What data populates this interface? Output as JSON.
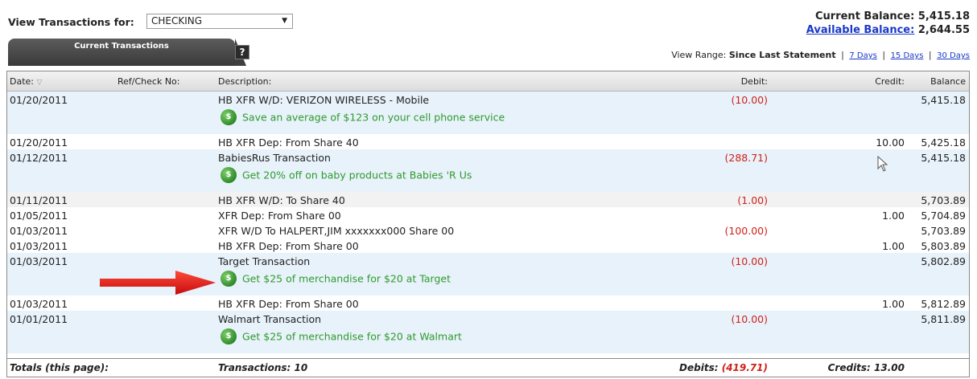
{
  "header": {
    "view_for_label": "View Transactions for:",
    "account_selected": "CHECKING",
    "current_balance": "Current Balance: 5,415.18",
    "available_balance_label": "Available Balance:",
    "available_balance_value": "2,644.55"
  },
  "tab": {
    "label": "Current Transactions",
    "help": "?"
  },
  "view_range": {
    "label": "View Range:",
    "selected": "Since Last Statement",
    "options": [
      "7 Days",
      "15 Days",
      "30 Days"
    ]
  },
  "columns": {
    "date": "Date:",
    "ref": "Ref/Check No:",
    "description": "Description:",
    "debit": "Debit:",
    "credit": "Credit:",
    "balance": "Balance"
  },
  "rows": [
    {
      "date": "01/20/2011",
      "description": "HB XFR W/D: VERIZON WIRELESS - Mobile",
      "debit": "(10.00)",
      "credit": "",
      "balance": "5,415.18",
      "offer": "Save an average of $123 on your cell phone service"
    },
    {
      "date": "01/20/2011",
      "description": "HB XFR Dep: From Share 40",
      "debit": "",
      "credit": "10.00",
      "balance": "5,425.18",
      "offer": ""
    },
    {
      "date": "01/12/2011",
      "description": "BabiesRus Transaction",
      "debit": "(288.71)",
      "credit": "",
      "balance": "5,415.18",
      "offer": "Get 20% off on baby products at Babies 'R Us"
    },
    {
      "date": "01/11/2011",
      "description": "HB XFR W/D: To Share 40",
      "debit": "(1.00)",
      "credit": "",
      "balance": "5,703.89",
      "offer": ""
    },
    {
      "date": "01/05/2011",
      "description": "XFR Dep: From Share 00",
      "debit": "",
      "credit": "1.00",
      "balance": "5,704.89",
      "offer": ""
    },
    {
      "date": "01/03/2011",
      "description": "XFR W/D To HALPERT,JIM xxxxxxx000 Share 00",
      "debit": "(100.00)",
      "credit": "",
      "balance": "5,703.89",
      "offer": ""
    },
    {
      "date": "01/03/2011",
      "description": "HB XFR Dep: From Share 00",
      "debit": "",
      "credit": "1.00",
      "balance": "5,803.89",
      "offer": ""
    },
    {
      "date": "01/03/2011",
      "description": "Target Transaction",
      "debit": "(10.00)",
      "credit": "",
      "balance": "5,802.89",
      "offer": "Get $25 of merchandise for $20 at Target"
    },
    {
      "date": "01/03/2011",
      "description": "HB XFR Dep: From Share 00",
      "debit": "",
      "credit": "1.00",
      "balance": "5,812.89",
      "offer": ""
    },
    {
      "date": "01/01/2011",
      "description": "Walmart Transaction",
      "debit": "(10.00)",
      "credit": "",
      "balance": "5,811.89",
      "offer": "Get $25 of merchandise for $20 at Walmart"
    }
  ],
  "totals": {
    "label": "Totals (this page):",
    "transactions": "Transactions: 10",
    "debits_label": "Debits:",
    "debits_value": "(419.71)",
    "credits": "Credits: 13.00"
  },
  "offer_badge_icon": "dollar-tag-icon",
  "colors": {
    "debit": "#d0211b",
    "offer_text": "#2f9a2f",
    "link": "#1a39c6",
    "arrow": "#e01414"
  }
}
